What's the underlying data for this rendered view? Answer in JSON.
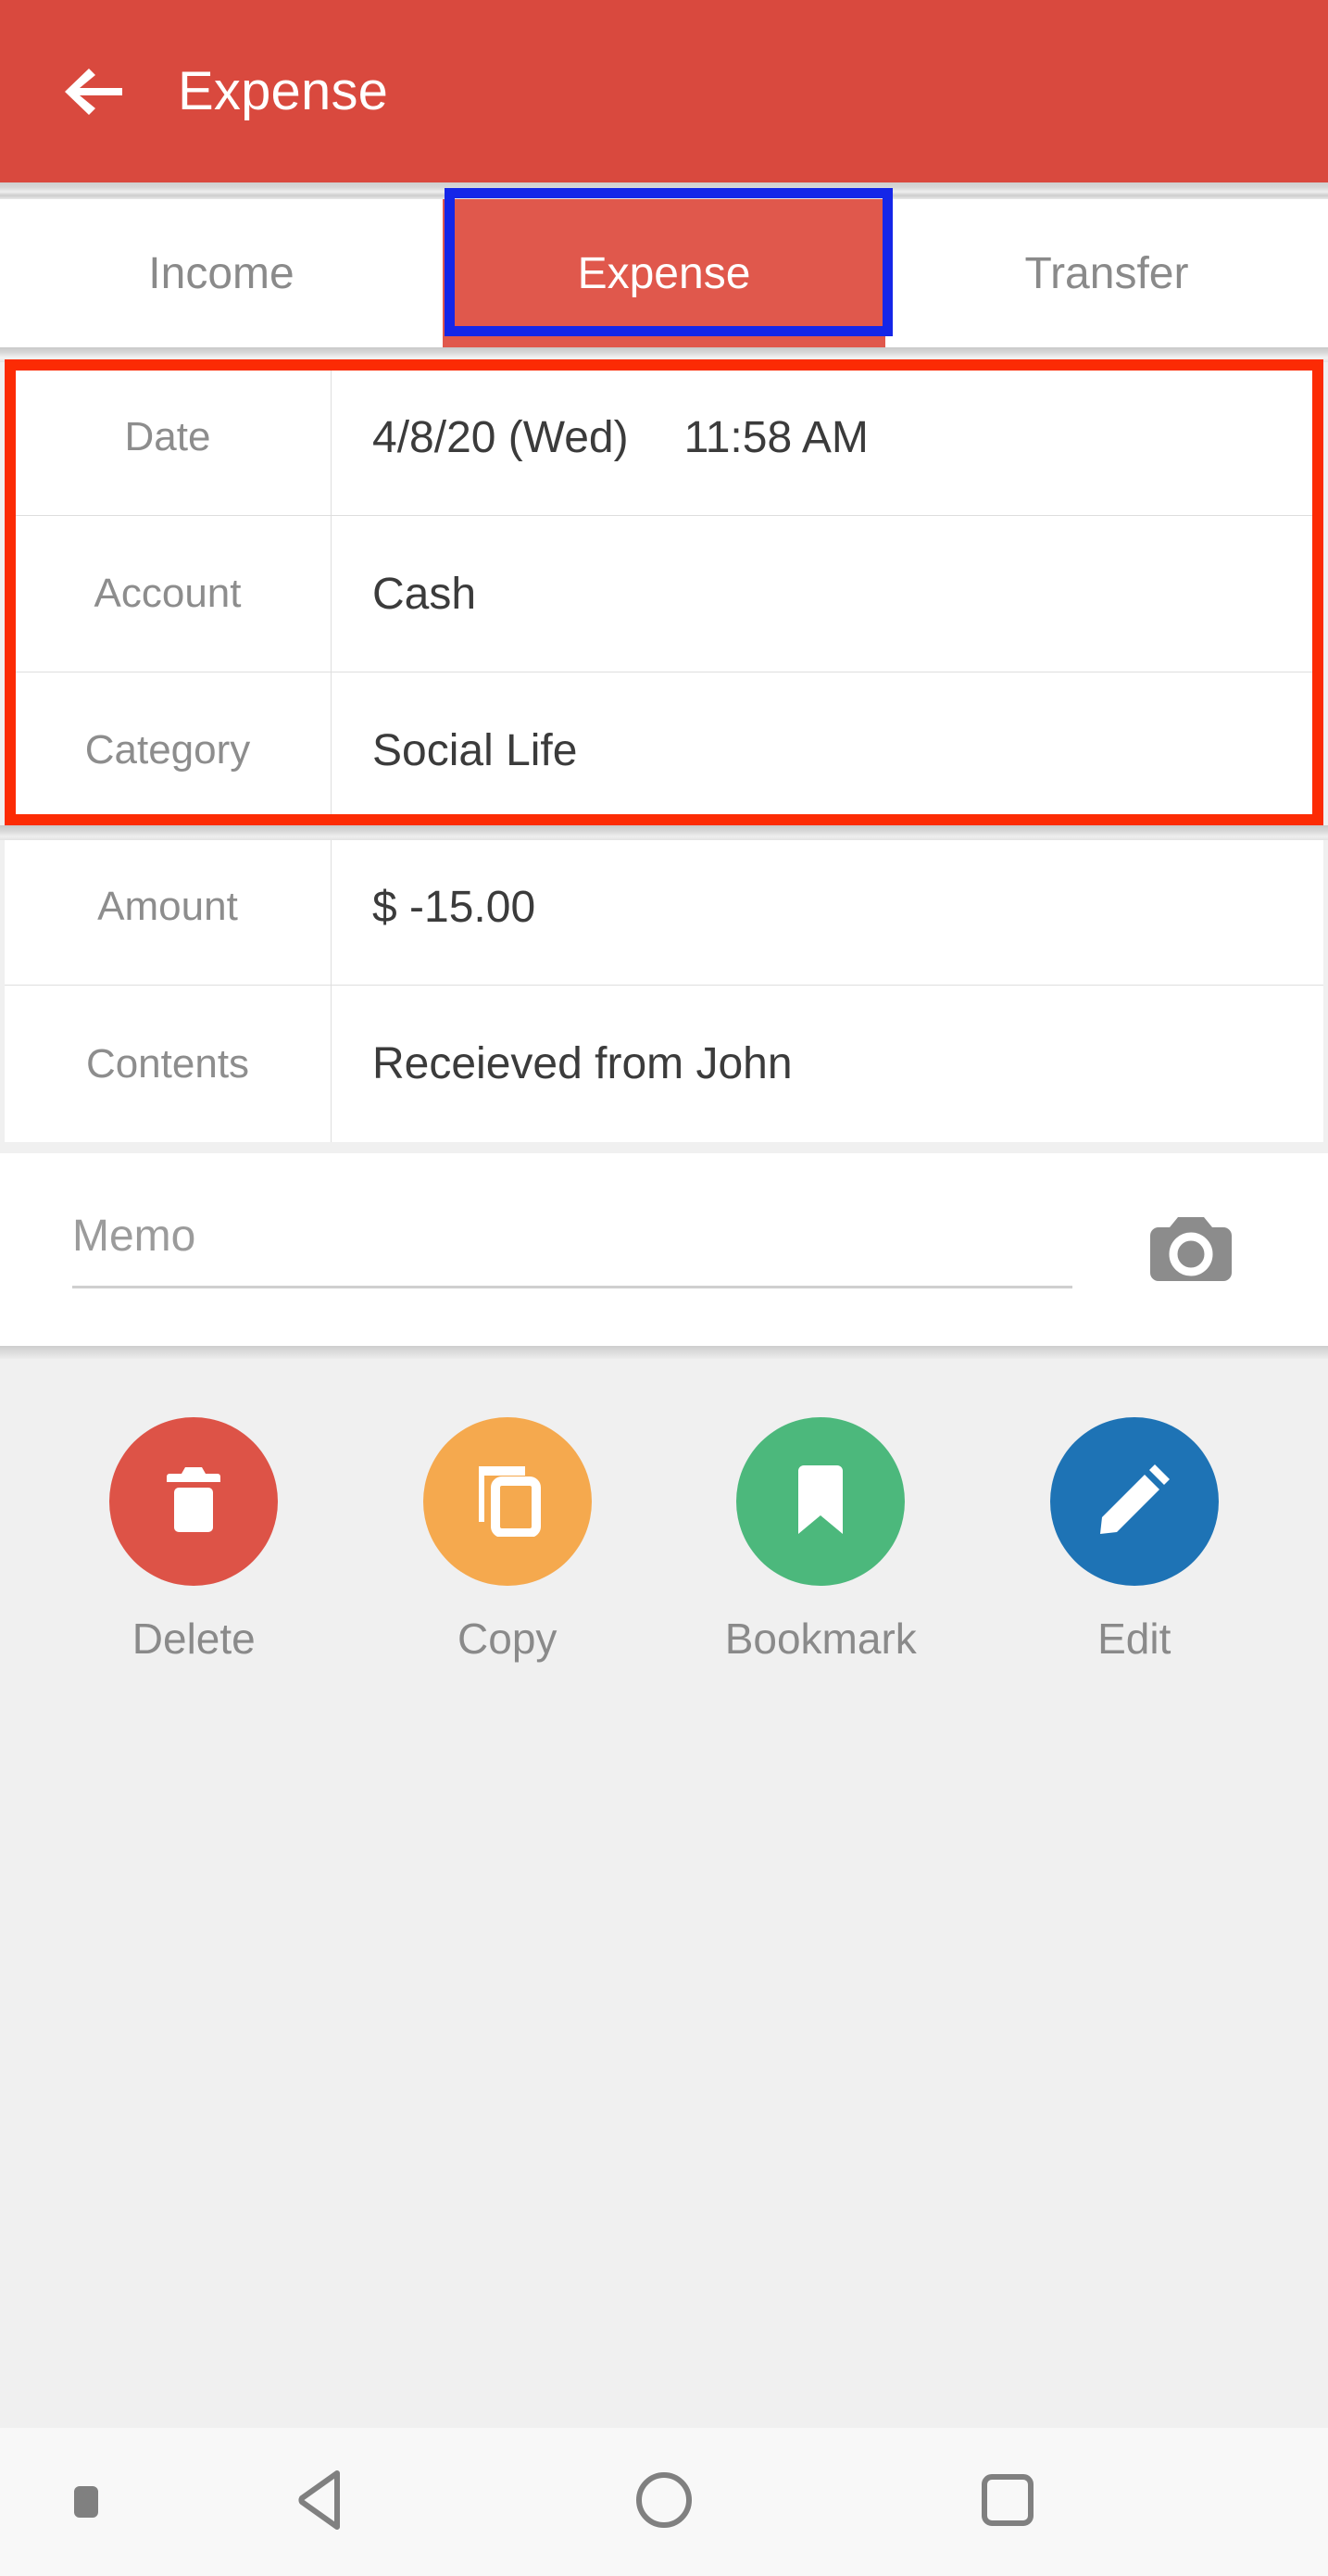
{
  "appbar": {
    "title": "Expense",
    "back_icon": "arrow-left-icon",
    "background_color": "#d9493e"
  },
  "tabs": [
    {
      "label": "Income",
      "selected": false
    },
    {
      "label": "Expense",
      "selected": true
    },
    {
      "label": "Transfer",
      "selected": false
    }
  ],
  "annotations": {
    "tab_highlight_color": "#1526e8",
    "table_highlight_color": "#fc2b04"
  },
  "detail": {
    "rows": [
      {
        "label": "Date",
        "value": "4/8/20 (Wed)",
        "value2": "11:58 AM"
      },
      {
        "label": "Account",
        "value": "Cash",
        "value2": ""
      },
      {
        "label": "Category",
        "value": "Social Life",
        "value2": ""
      },
      {
        "label": "Amount",
        "value": "$ -15.00",
        "value2": ""
      },
      {
        "label": "Contents",
        "value": "Receieved from John",
        "value2": ""
      }
    ]
  },
  "memo": {
    "placeholder": "Memo",
    "value": "",
    "camera_icon": "camera-icon"
  },
  "actions": [
    {
      "label": "Delete",
      "icon": "trash-icon",
      "color": "#dd5347"
    },
    {
      "label": "Copy",
      "icon": "copy-icon",
      "color": "#f5a94e"
    },
    {
      "label": "Bookmark",
      "icon": "bookmark-icon",
      "color": "#4cb87c"
    },
    {
      "label": "Edit",
      "icon": "pencil-icon",
      "color": "#1e73b5"
    }
  ],
  "navbar": {
    "dot": "indicator-dot-icon",
    "back": "nav-back-triangle-icon",
    "home": "nav-home-circle-icon",
    "recents": "nav-recents-square-icon"
  }
}
